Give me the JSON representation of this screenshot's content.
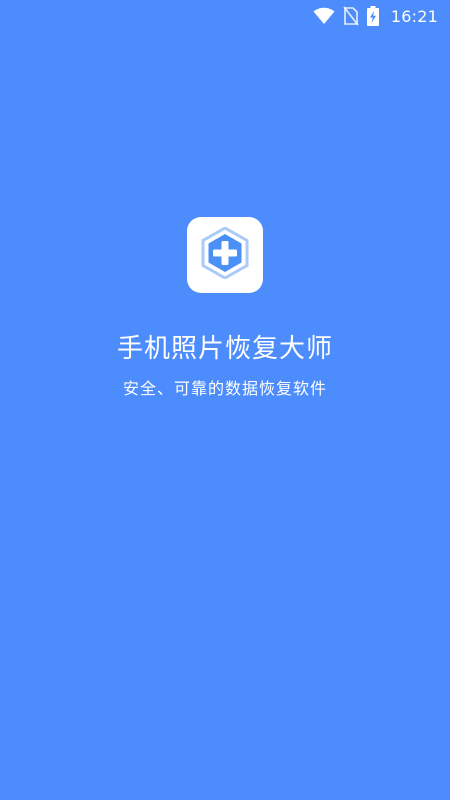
{
  "status_bar": {
    "time": "16:21",
    "icons": [
      "wifi-icon",
      "no-sim-icon",
      "battery-charging-icon"
    ]
  },
  "app": {
    "icon": "hexagon-plus-icon",
    "title": "手机照片恢复大师",
    "tagline": "安全、可靠的数据恢复软件"
  },
  "colors": {
    "background": "#4D8CFD",
    "icon_primary": "#4A90F7",
    "icon_light": "#A9CBF9",
    "text": "#FFFFFF"
  }
}
